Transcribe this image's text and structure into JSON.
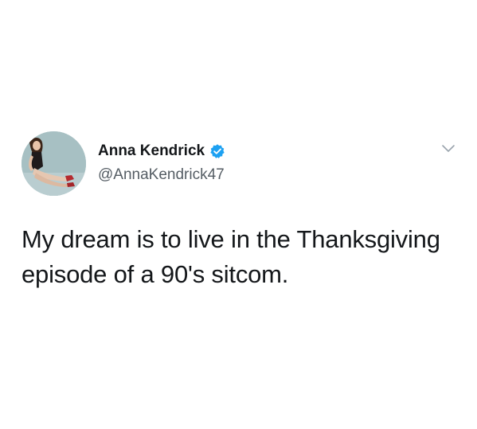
{
  "author": {
    "name": "Anna Kendrick",
    "handle": "@AnnaKendrick47",
    "verified": true
  },
  "tweet": {
    "lines": [
      "My dream is to live in the Thanksgiving",
      "episode of a 90's sitcom."
    ]
  },
  "icons": {
    "verified": "verified-badge-icon",
    "menu": "chevron-down-icon"
  },
  "colors": {
    "verified_blue": "#1da1f2",
    "text": "#14171a",
    "handle": "#555d64",
    "caret": "#9aa4ad"
  }
}
